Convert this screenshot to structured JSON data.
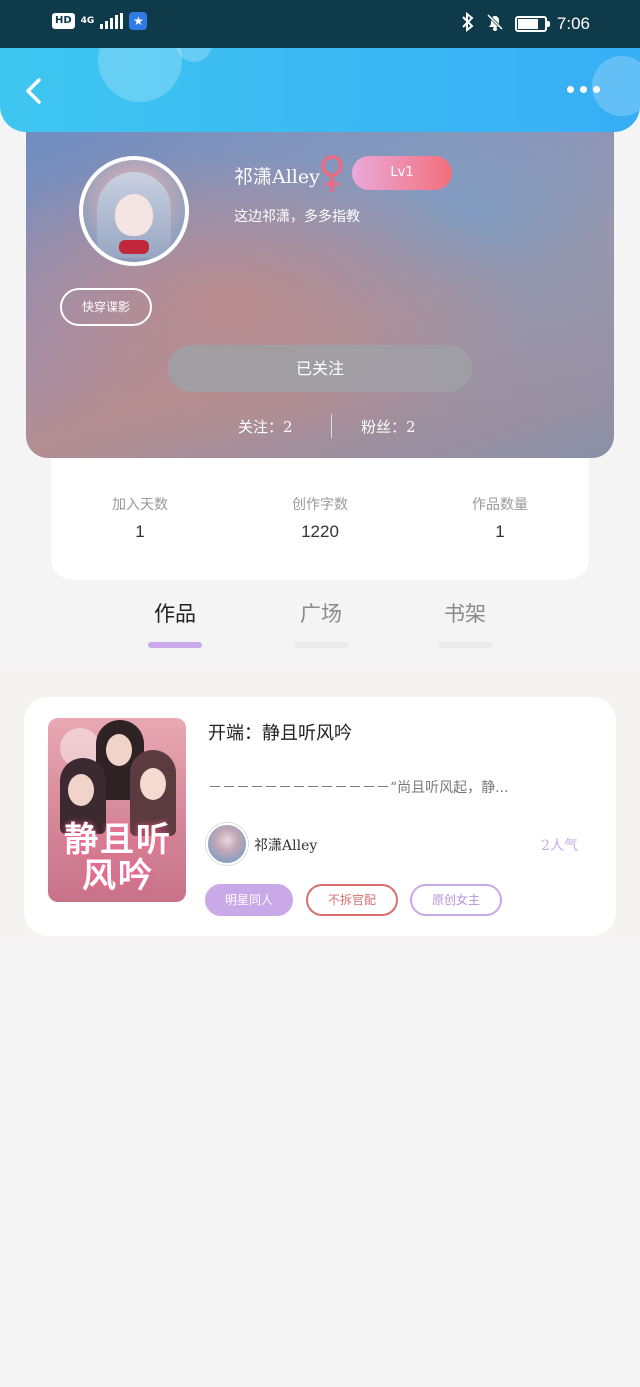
{
  "status_bar": {
    "hd": "HD",
    "network": "4G",
    "time": "7:06",
    "battery_level": 0.7
  },
  "header": {
    "back_icon": "chevron-left-icon",
    "more_icon": "more-horizontal-icon"
  },
  "profile": {
    "username": "祁潇Alley",
    "gender_icon": "female-symbol-icon",
    "level": "Lv1",
    "bio": "这边祁潇，多多指教",
    "tag": "快穿谍影",
    "follow_button": "已关注",
    "following_stat": "关注：2",
    "fans_stat": "粉丝：2",
    "colors": {
      "gender": "#e96a83",
      "level_start": "#e9a9d9",
      "level_end": "#f36f7c"
    }
  },
  "numbers": [
    {
      "label": "加入天数",
      "value": "1"
    },
    {
      "label": "创作字数",
      "value": "1220"
    },
    {
      "label": "作品数量",
      "value": "1"
    }
  ],
  "tabs": [
    {
      "label": "作品",
      "active": true
    },
    {
      "label": "广场",
      "active": false
    },
    {
      "label": "书架",
      "active": false
    }
  ],
  "work": {
    "cover_title": "静且听风吟",
    "title": "开端：静且听风吟",
    "excerpt": "－－－－－－－－－－－－－“尚且听风起，静...",
    "author": "祁潇Alley",
    "popularity": "2人气",
    "chips": [
      "明星同人",
      "不拆官配",
      "原创女主"
    ]
  }
}
